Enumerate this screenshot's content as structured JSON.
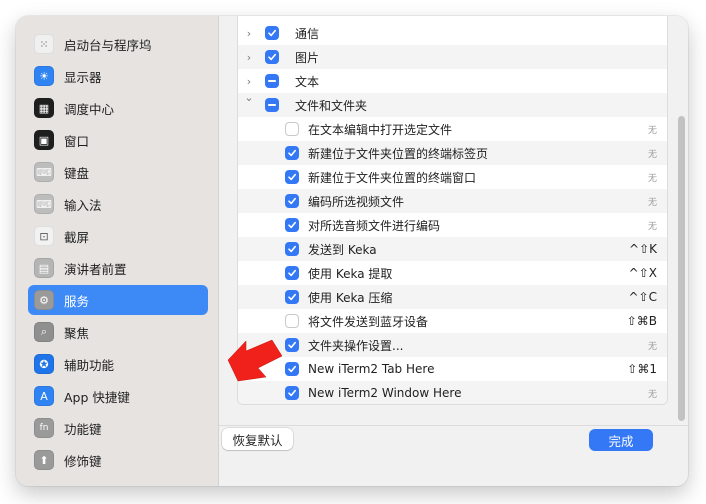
{
  "sidebar": {
    "items": [
      {
        "label": "启动台与程序坞",
        "icon": "launchpad-icon",
        "color": "#f0f0f0",
        "glyph": "⁙"
      },
      {
        "label": "显示器",
        "icon": "display-icon",
        "color": "#2f83f2",
        "glyph": "☀"
      },
      {
        "label": "调度中心",
        "icon": "mission-control-icon",
        "color": "#1f1f1f",
        "glyph": "▦"
      },
      {
        "label": "窗口",
        "icon": "window-icon",
        "color": "#1f1f1f",
        "glyph": "▣"
      },
      {
        "label": "键盘",
        "icon": "keyboard-icon",
        "color": "#bdbdbd",
        "glyph": "⌨"
      },
      {
        "label": "输入法",
        "icon": "input-method-icon",
        "color": "#bdbdbd",
        "glyph": "⌨"
      },
      {
        "label": "截屏",
        "icon": "screenshot-icon",
        "color": "#f2f2f2",
        "glyph": "⊡"
      },
      {
        "label": "演讲者前置",
        "icon": "presenter-icon",
        "color": "#b5b5b5",
        "glyph": "▤"
      },
      {
        "label": "服务",
        "icon": "gear-icon",
        "color": "#9a9a9a",
        "glyph": "⚙"
      },
      {
        "label": "聚焦",
        "icon": "spotlight-icon",
        "color": "#8f8f8f",
        "glyph": "⌕"
      },
      {
        "label": "辅助功能",
        "icon": "accessibility-icon",
        "color": "#1f74e8",
        "glyph": "✪"
      },
      {
        "label": "App 快捷键",
        "icon": "app-shortcuts-icon",
        "color": "#2f83f2",
        "glyph": "A"
      },
      {
        "label": "功能键",
        "icon": "fn-key-icon",
        "color": "#9a9a9a",
        "glyph": "fn"
      },
      {
        "label": "修饰键",
        "icon": "modifier-key-icon",
        "color": "#9a9a9a",
        "glyph": "⬆"
      }
    ]
  },
  "services": {
    "rows": [
      {
        "type": "group",
        "label": "通信",
        "state": "on",
        "expanded": false
      },
      {
        "type": "group",
        "label": "图片",
        "state": "on",
        "expanded": false
      },
      {
        "type": "group",
        "label": "文本",
        "state": "mixed",
        "expanded": false
      },
      {
        "type": "group",
        "label": "文件和文件夹",
        "state": "mixed",
        "expanded": true
      },
      {
        "type": "item",
        "label": "在文本编辑中打开选定文件",
        "state": "off",
        "shortcut": "无"
      },
      {
        "type": "item",
        "label": "新建位于文件夹位置的终端标签页",
        "state": "on",
        "shortcut": "无"
      },
      {
        "type": "item",
        "label": "新建位于文件夹位置的终端窗口",
        "state": "on",
        "shortcut": "无"
      },
      {
        "type": "item",
        "label": "编码所选视频文件",
        "state": "on",
        "shortcut": "无"
      },
      {
        "type": "item",
        "label": "对所选音频文件进行编码",
        "state": "on",
        "shortcut": "无"
      },
      {
        "type": "item",
        "label": "发送到 Keka",
        "state": "on",
        "shortcut": "^⇧K"
      },
      {
        "type": "item",
        "label": "使用 Keka 提取",
        "state": "on",
        "shortcut": "^⇧X"
      },
      {
        "type": "item",
        "label": "使用 Keka 压缩",
        "state": "on",
        "shortcut": "^⇧C"
      },
      {
        "type": "item",
        "label": "将文件发送到蓝牙设备",
        "state": "off",
        "shortcut": "⇧⌘B"
      },
      {
        "type": "item",
        "label": "文件夹操作设置...",
        "state": "on",
        "shortcut": "无"
      },
      {
        "type": "item",
        "label": "New iTerm2 Tab Here",
        "state": "on",
        "shortcut": "⇧⌘1"
      },
      {
        "type": "item",
        "label": "New iTerm2 Window Here",
        "state": "on",
        "shortcut": "无"
      }
    ]
  },
  "footer": {
    "reset_label": "恢复默认",
    "done_label": "完成"
  },
  "colors": {
    "accent": "#3478f6",
    "annotation_arrow": "#f0201b"
  }
}
